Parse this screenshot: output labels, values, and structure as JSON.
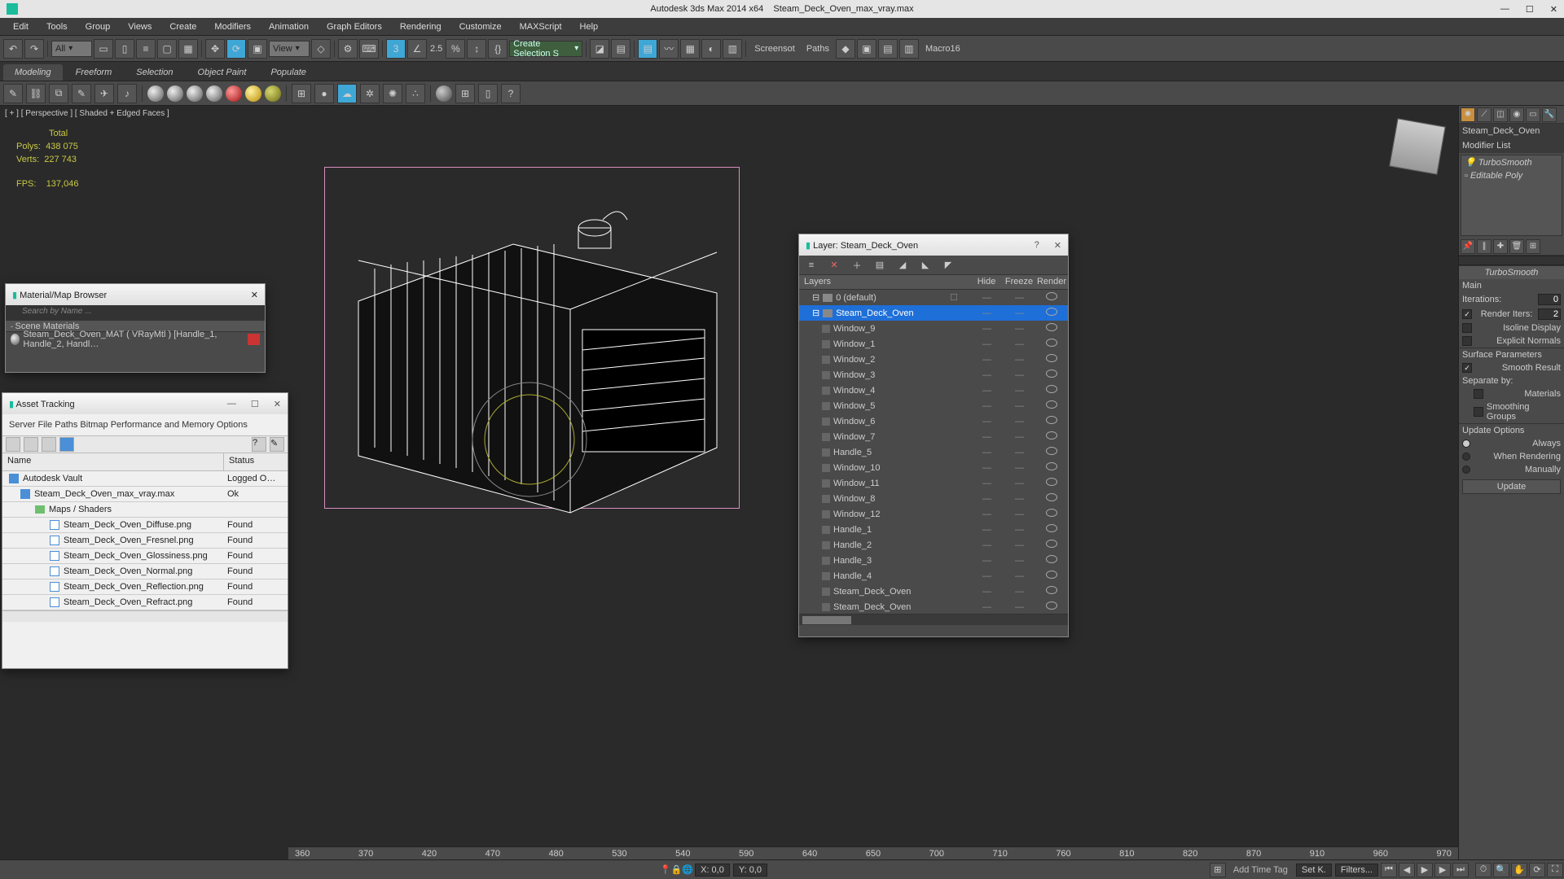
{
  "titlebar": {
    "app": "Autodesk 3ds Max  2014 x64",
    "file": "Steam_Deck_Oven_max_vray.max"
  },
  "menus": [
    "Edit",
    "Tools",
    "Group",
    "Views",
    "Create",
    "Modifiers",
    "Animation",
    "Graph Editors",
    "Rendering",
    "Customize",
    "MAXScript",
    "Help"
  ],
  "toolbar": {
    "all_dd": "All",
    "view_dd": "View",
    "spin": "2.5",
    "create_sel_dd": "Create Selection S",
    "labels": [
      "Screensot",
      "Paths",
      "Macro16"
    ]
  },
  "tabs": [
    "Modeling",
    "Freeform",
    "Selection",
    "Object Paint",
    "Populate"
  ],
  "viewport": {
    "label": "[ + ] [ Perspective ] [ Shaded + Edged Faces ]"
  },
  "stats": {
    "total": "Total",
    "polys_l": "Polys:",
    "polys_v": "438 075",
    "verts_l": "Verts:",
    "verts_v": "227 743",
    "fps_l": "FPS:",
    "fps_v": "137,046"
  },
  "right": {
    "obj_name": "Steam_Deck_Oven",
    "mod_title": "Modifier List",
    "mods": [
      "TurboSmooth",
      "Editable Poly"
    ],
    "rollup": "TurboSmooth",
    "main": "Main",
    "iter_l": "Iterations:",
    "iter_v": "0",
    "riter_l": "Render Iters:",
    "riter_v": "2",
    "iso": "Isoline Display",
    "expn": "Explicit Normals",
    "surf": "Surface Parameters",
    "smooth": "Smooth Result",
    "sep": "Separate by:",
    "mat": "Materials",
    "sg": "Smoothing Groups",
    "upd": "Update Options",
    "always": "Always",
    "when": "When Rendering",
    "man": "Manually",
    "btn": "Update"
  },
  "layer": {
    "title": "Layer: Steam_Deck_Oven",
    "cols": [
      "Layers",
      "Hide",
      "Freeze",
      "Render"
    ],
    "rows": [
      {
        "n": "0 (default)",
        "l": 0,
        "t": "layer",
        "sel": false,
        "chk": true
      },
      {
        "n": "Steam_Deck_Oven",
        "l": 0,
        "t": "layer",
        "sel": true,
        "chk": false
      },
      {
        "n": "Window_9",
        "l": 1,
        "t": "obj"
      },
      {
        "n": "Window_1",
        "l": 1,
        "t": "obj"
      },
      {
        "n": "Window_2",
        "l": 1,
        "t": "obj"
      },
      {
        "n": "Window_3",
        "l": 1,
        "t": "obj"
      },
      {
        "n": "Window_4",
        "l": 1,
        "t": "obj"
      },
      {
        "n": "Window_5",
        "l": 1,
        "t": "obj"
      },
      {
        "n": "Window_6",
        "l": 1,
        "t": "obj"
      },
      {
        "n": "Window_7",
        "l": 1,
        "t": "obj"
      },
      {
        "n": "Handle_5",
        "l": 1,
        "t": "obj"
      },
      {
        "n": "Window_10",
        "l": 1,
        "t": "obj"
      },
      {
        "n": "Window_11",
        "l": 1,
        "t": "obj"
      },
      {
        "n": "Window_8",
        "l": 1,
        "t": "obj"
      },
      {
        "n": "Window_12",
        "l": 1,
        "t": "obj"
      },
      {
        "n": "Handle_1",
        "l": 1,
        "t": "obj"
      },
      {
        "n": "Handle_2",
        "l": 1,
        "t": "obj"
      },
      {
        "n": "Handle_3",
        "l": 1,
        "t": "obj"
      },
      {
        "n": "Handle_4",
        "l": 1,
        "t": "obj"
      },
      {
        "n": "Steam_Deck_Oven",
        "l": 1,
        "t": "obj"
      },
      {
        "n": "Steam_Deck_Oven",
        "l": 1,
        "t": "obj"
      }
    ]
  },
  "mat": {
    "title": "Material/Map Browser",
    "search": "Search by Name ...",
    "cat": "Scene Materials",
    "item": "Steam_Deck_Oven_MAT ( VRayMtl )  [Handle_1, Handle_2, Handl…"
  },
  "asset": {
    "title": "Asset Tracking",
    "menu": "Server    File    Paths    Bitmap Performance and Memory Options",
    "h_name": "Name",
    "h_status": "Status",
    "rows": [
      {
        "n": "Autodesk Vault",
        "s": "Logged O…",
        "l": 0,
        "i": "vault"
      },
      {
        "n": "Steam_Deck_Oven_max_vray.max",
        "s": "Ok",
        "l": 1,
        "i": "file"
      },
      {
        "n": "Maps / Shaders",
        "s": "",
        "l": 2,
        "i": "folder"
      },
      {
        "n": "Steam_Deck_Oven_Diffuse.png",
        "s": "Found",
        "l": 3,
        "i": "img"
      },
      {
        "n": "Steam_Deck_Oven_Fresnel.png",
        "s": "Found",
        "l": 3,
        "i": "img"
      },
      {
        "n": "Steam_Deck_Oven_Glossiness.png",
        "s": "Found",
        "l": 3,
        "i": "img"
      },
      {
        "n": "Steam_Deck_Oven_Normal.png",
        "s": "Found",
        "l": 3,
        "i": "img"
      },
      {
        "n": "Steam_Deck_Oven_Reflection.png",
        "s": "Found",
        "l": 3,
        "i": "img"
      },
      {
        "n": "Steam_Deck_Oven_Refract.png",
        "s": "Found",
        "l": 3,
        "i": "img"
      }
    ]
  },
  "timeline": {
    "ticks": [
      "360",
      "370",
      "420",
      "470",
      "480",
      "530",
      "540",
      "590",
      "640",
      "650",
      "700",
      "710",
      "760",
      "810",
      "820",
      "870",
      "910",
      "960",
      "970"
    ]
  },
  "status": {
    "x": "X: 0,0",
    "y": "Y: 0,0",
    "addtime": "Add Time Tag",
    "setk": "Set K.",
    "filters": "Filters..."
  }
}
